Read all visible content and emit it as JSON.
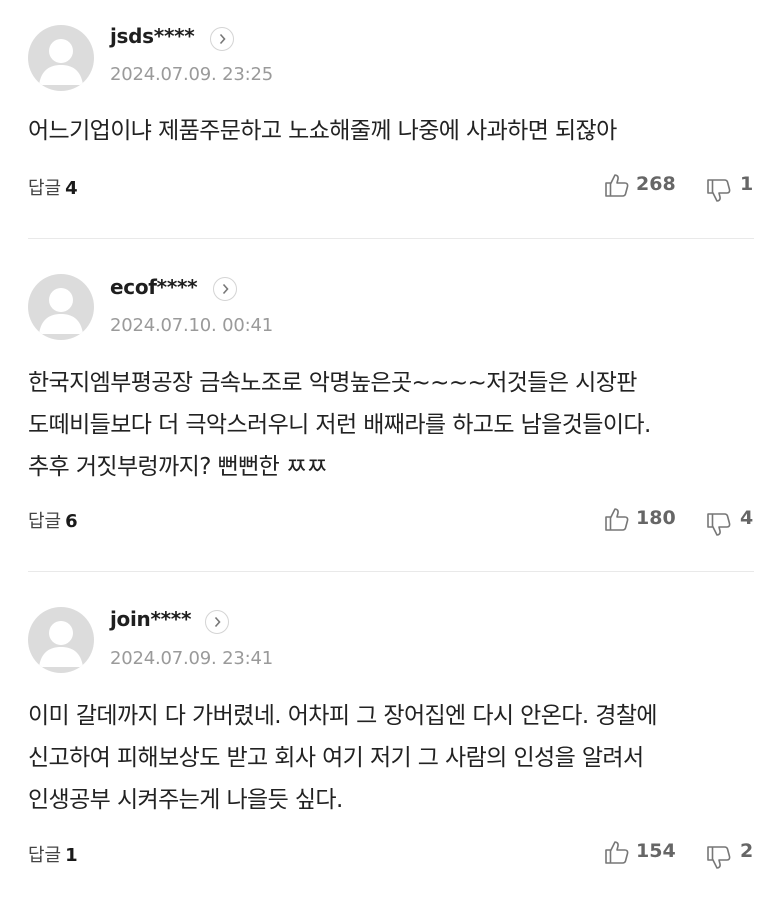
{
  "comments": [
    {
      "username": "jsds****",
      "date": "2024.07.09. 23:25",
      "lines": [
        "어느기업이냐 제품주문하고 노쇼해줄께 나중에 사과하면 되잖아"
      ],
      "reply_label": "답글",
      "reply_count": "4",
      "likes": "268",
      "dislikes": "1"
    },
    {
      "username": "ecof****",
      "date": "2024.07.10. 00:41",
      "lines": [
        "한국지엠부평공장 금속노조로 악명높은곳~~~~저것들은 시장판",
        "도떼비들보다 더 극악스러우니 저런 배째라를 하고도 남을것들이다.",
        "추후 거짓부렁까지? 뻔뻔한 ㅉㅉ"
      ],
      "reply_label": "답글",
      "reply_count": "6",
      "likes": "180",
      "dislikes": "4"
    },
    {
      "username": "join****",
      "date": "2024.07.09. 23:41",
      "lines": [
        "이미 갈데까지 다 가버렸네. 어차피 그 장어집엔 다시 안온다. 경찰에",
        "신고하여 피해보상도 받고 회사 여기 저기 그 사람의 인성을 알려서",
        "인생공부 시켜주는게 나을듯 싶다."
      ],
      "reply_label": "답글",
      "reply_count": "1",
      "likes": "154",
      "dislikes": "2"
    }
  ]
}
